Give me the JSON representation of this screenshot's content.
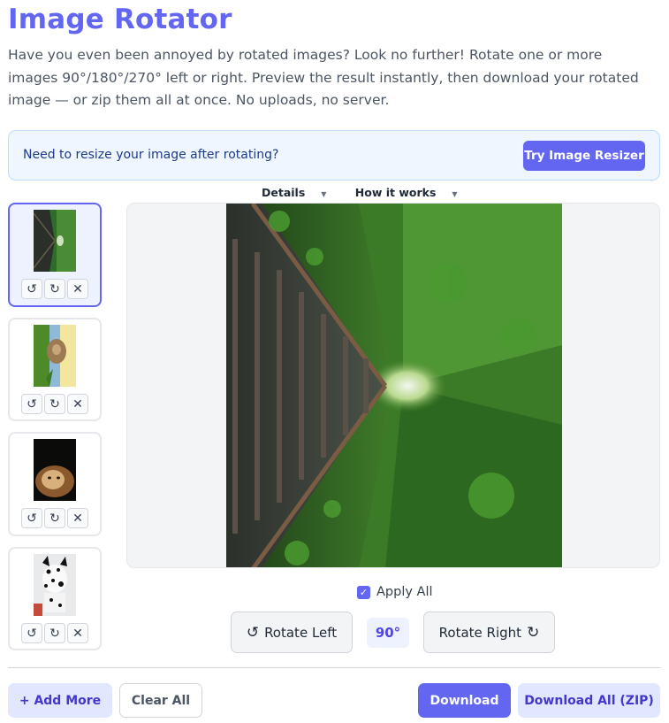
{
  "header": {
    "title": "Image Rotator",
    "description": "Have you even been annoyed by rotated images? Look no further! Rotate one or more images 90°/180°/270° left or right. Preview the result instantly, then download your rotated image — or zip them all at once. No uploads, no server."
  },
  "banner": {
    "text": "Need to resize your image after rotating?",
    "button": "Try Image Resizer"
  },
  "links": {
    "details": "Details",
    "how": "How it works"
  },
  "thumbnails": {
    "rotate_left_glyph": "↺",
    "rotate_right_glyph": "↻",
    "remove_glyph": "✕",
    "items": [
      {
        "subject": "railway-forest",
        "selected": true
      },
      {
        "subject": "cat-in-grass",
        "selected": false
      },
      {
        "subject": "lion",
        "selected": false
      },
      {
        "subject": "dalmatian-dog",
        "selected": false
      }
    ]
  },
  "controls": {
    "apply_all": "Apply All",
    "apply_all_checked": true,
    "rotate_left": "Rotate Left",
    "rotate_right": "Rotate Right",
    "degrees": "90°"
  },
  "footer": {
    "add_more": "+ Add More",
    "clear_all": "Clear All",
    "download": "Download",
    "download_all": "Download All (ZIP)"
  },
  "colors": {
    "accent": "#6366f1",
    "accent_light": "#e0e7ff",
    "banner_bg": "#eff6ff"
  }
}
